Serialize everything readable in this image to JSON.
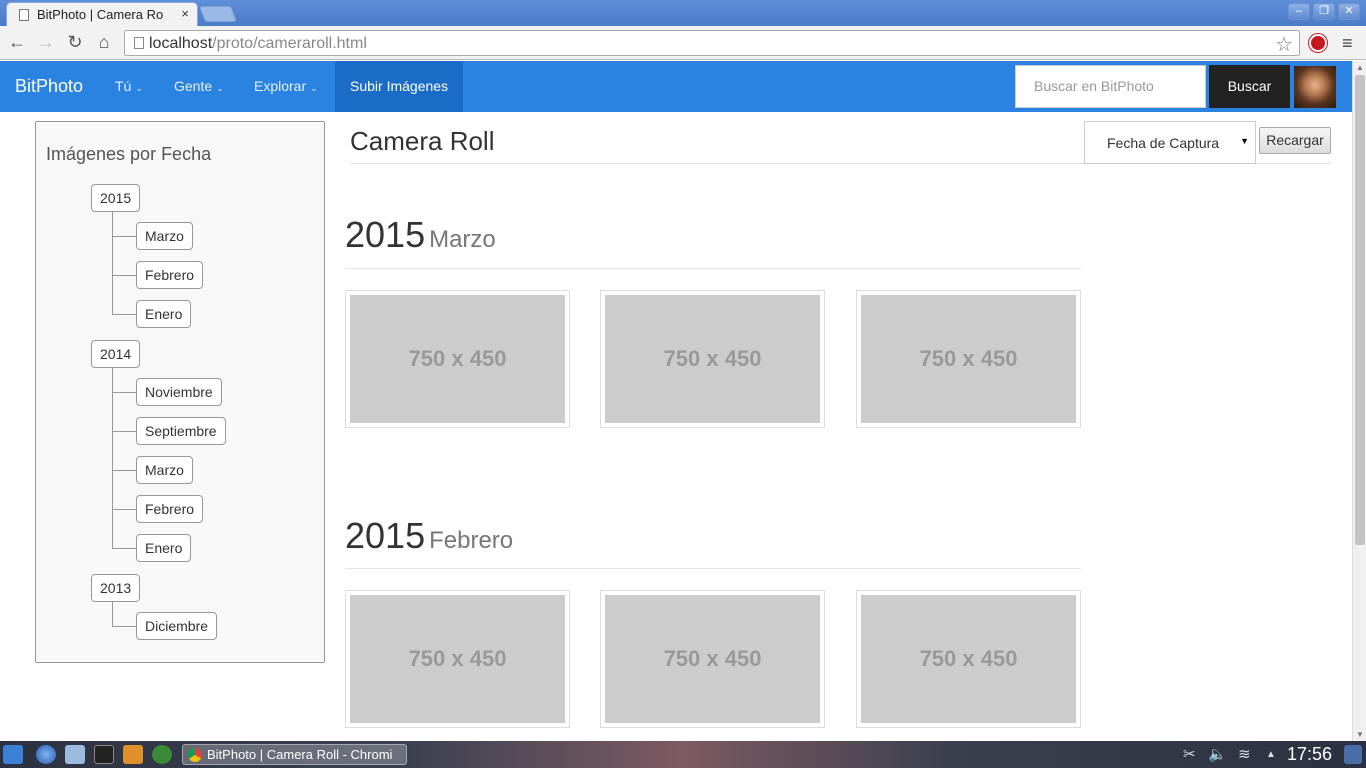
{
  "browser": {
    "tab_title": "BitPhoto | Camera Ro",
    "tab_close": "×",
    "url_host": "localhost",
    "url_path": "/proto/cameraroll.html",
    "window_buttons": [
      "–",
      "❐",
      "✕"
    ]
  },
  "navbar": {
    "brand": "BitPhoto",
    "items": [
      {
        "label": "Tú"
      },
      {
        "label": "Gente"
      },
      {
        "label": "Explorar"
      },
      {
        "label": "Subir Imágenes"
      }
    ],
    "search_placeholder": "Buscar en BitPhoto",
    "search_button": "Buscar"
  },
  "sidebar": {
    "title": "Imágenes por Fecha",
    "years": [
      {
        "year": "2015",
        "months": [
          "Marzo",
          "Febrero",
          "Enero"
        ]
      },
      {
        "year": "2014",
        "months": [
          "Noviembre",
          "Septiembre",
          "Marzo",
          "Febrero",
          "Enero"
        ]
      },
      {
        "year": "2013",
        "months": [
          "Diciembre"
        ]
      }
    ]
  },
  "main": {
    "title": "Camera Roll",
    "sort_select": "Fecha de Captura",
    "reload_button": "Recargar",
    "sections": [
      {
        "year": "2015",
        "month": "Marzo",
        "photos": [
          "750 x 450",
          "750 x 450",
          "750 x 450"
        ]
      },
      {
        "year": "2015",
        "month": "Febrero",
        "photos": [
          "750 x 450",
          "750 x 450",
          "750 x 450"
        ]
      }
    ]
  },
  "taskbar": {
    "window_title": "BitPhoto | Camera Roll - Chromi",
    "clock": "17:56"
  }
}
